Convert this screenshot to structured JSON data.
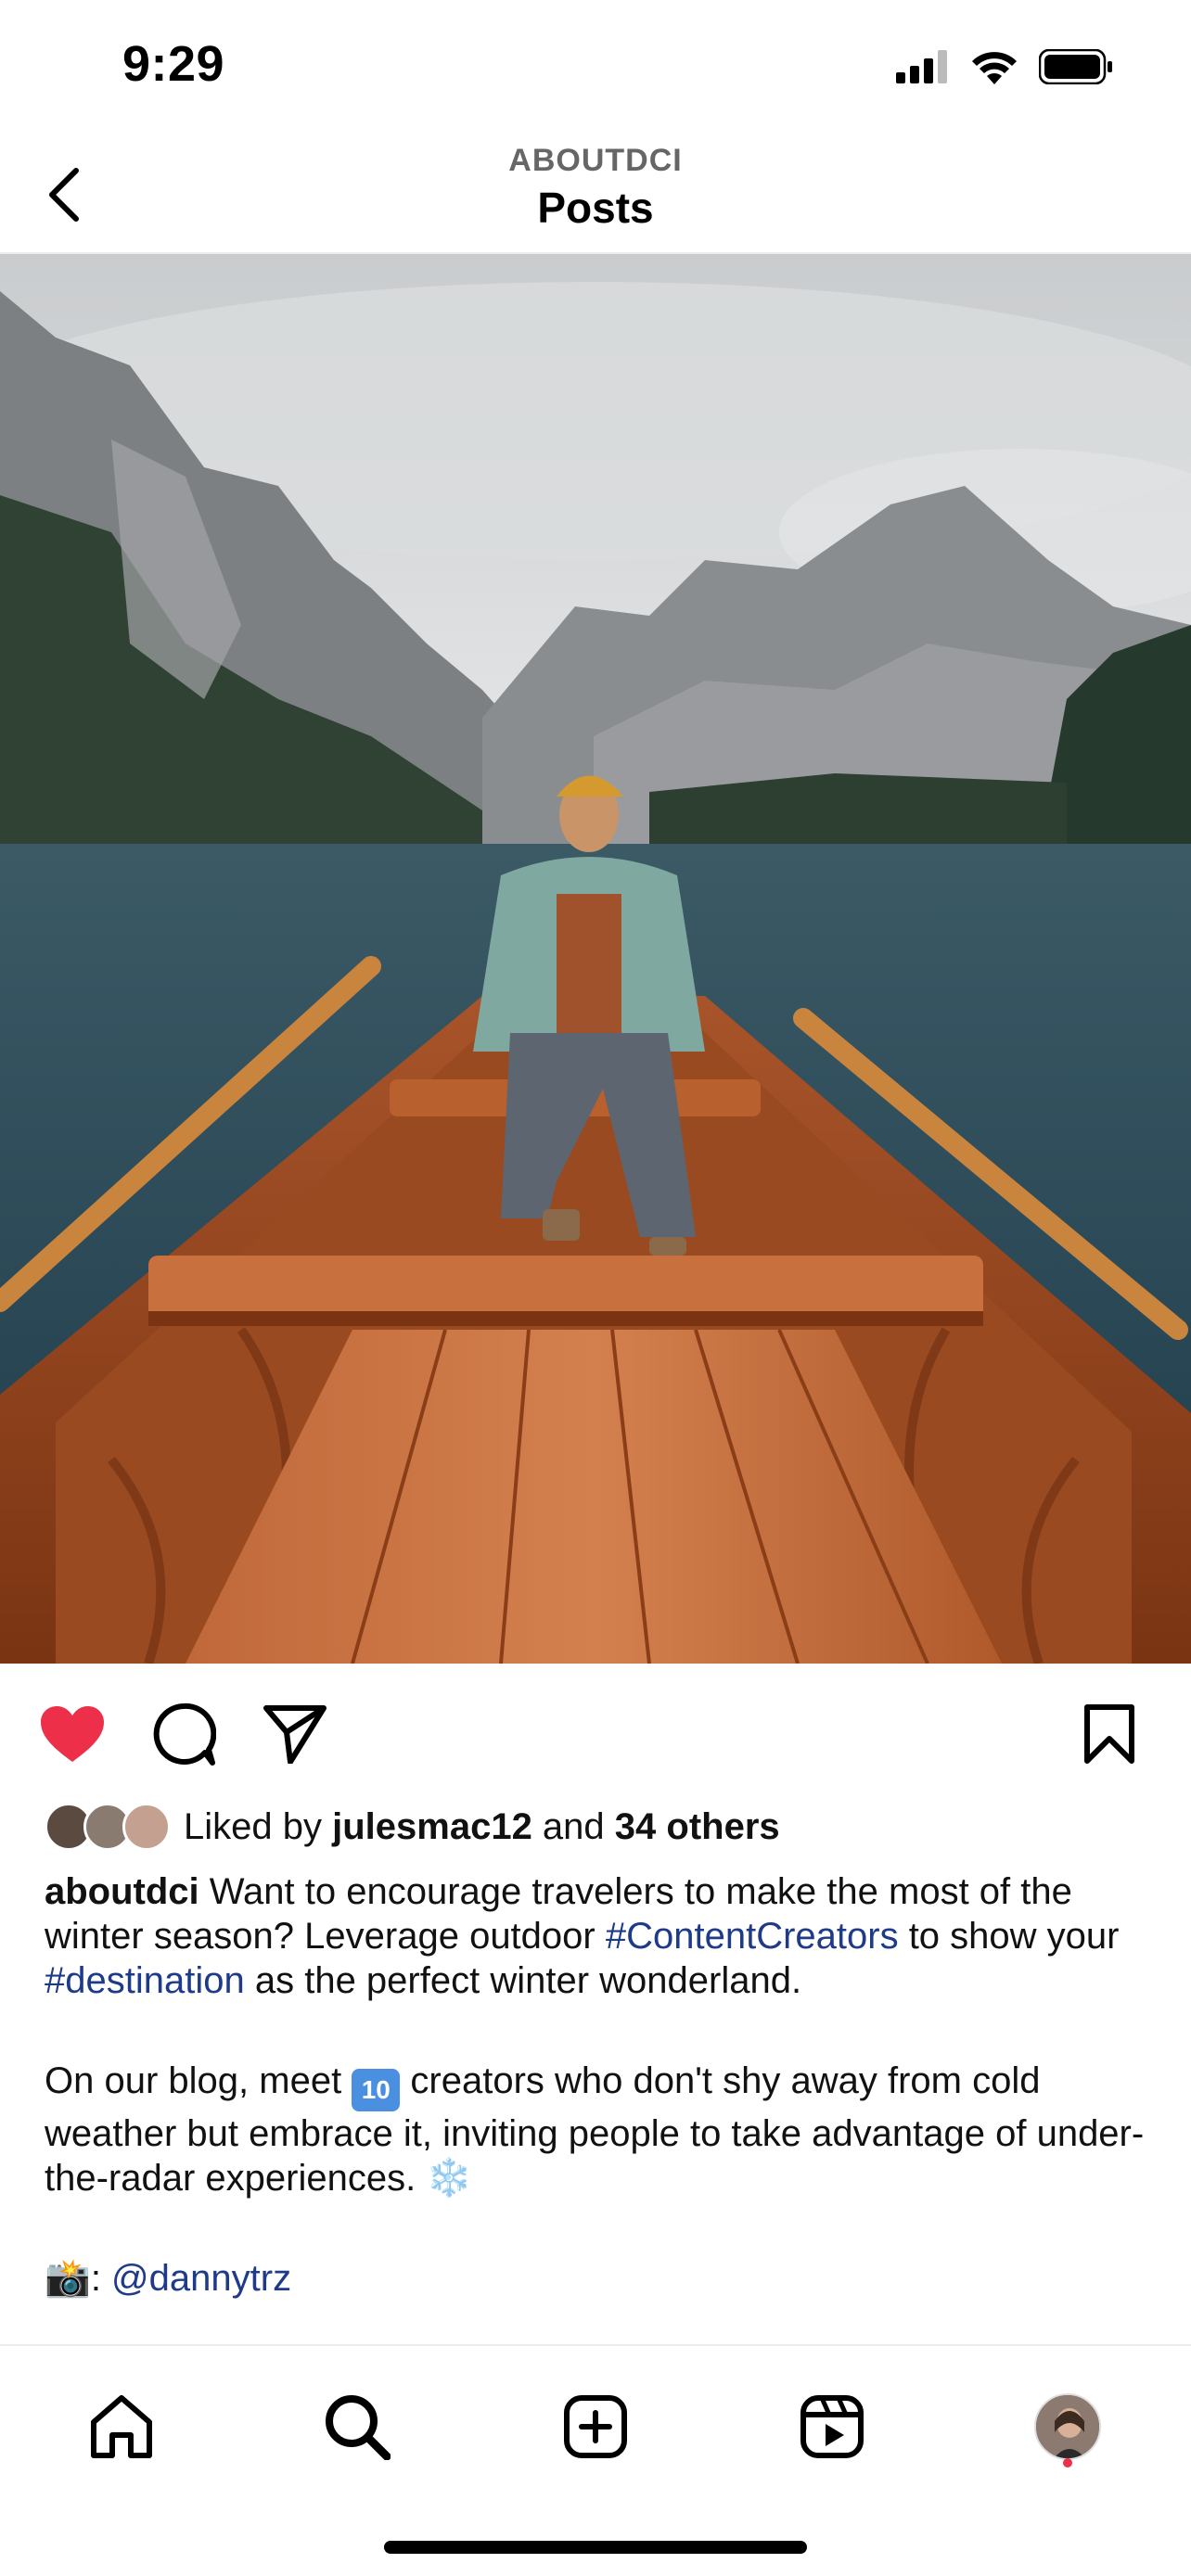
{
  "status_bar": {
    "time": "9:29",
    "icons": [
      "signal-icon",
      "wifi-icon",
      "battery-icon"
    ]
  },
  "header": {
    "account": "ABOUTDCI",
    "title": "Posts",
    "back_icon": "chevron-left-icon"
  },
  "post": {
    "image_alt": "Person sitting in a wooden rowboat on a mountain lake with misty peaks",
    "liked": true,
    "like_color": "#ed2f4a",
    "actions": [
      "heart-icon",
      "comment-icon",
      "share-icon",
      "bookmark-icon"
    ],
    "likes": {
      "prefix": "Liked by ",
      "user": "julesmac12",
      "middle": " and ",
      "others": "34 others"
    },
    "caption": {
      "username": "aboutdci",
      "line1_text": " Want to encourage travelers to make the most of the winter season? Leverage outdoor ",
      "hashtag1": "#ContentCreators",
      "line1_after": " to show your ",
      "hashtag2": "#destination",
      "line1_end": " as the perfect winter wonderland.",
      "para2_start": "On our blog, meet ",
      "para2_emoji": "10",
      "para2_rest": " creators who don't shy away from cold weather but embrace it, inviting people to take advantage of under-the-radar experiences. ",
      "para2_end_emoji": "❄️",
      "credit_emoji": "📸",
      "credit_sep": ": ",
      "credit_user": "@dannytrz"
    }
  },
  "tabbar": {
    "tabs": [
      "home-icon",
      "search-icon",
      "create-icon",
      "reels-icon",
      "profile-avatar"
    ],
    "notification_color": "#ed2f4a"
  }
}
